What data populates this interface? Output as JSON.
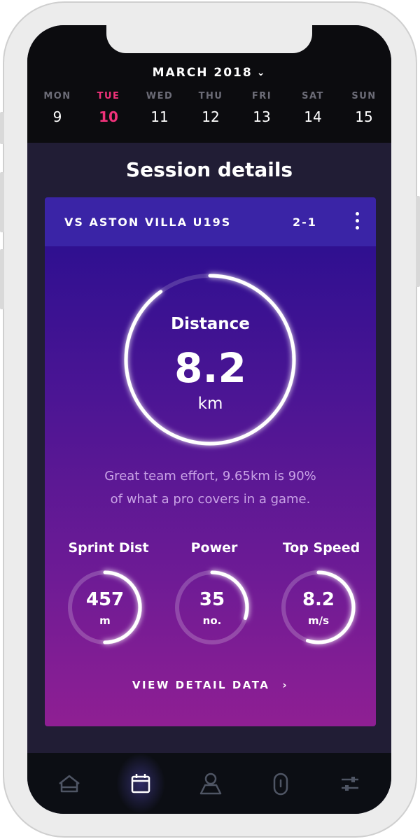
{
  "calendar": {
    "month_label": "MARCH 2018",
    "days": [
      {
        "name": "MON",
        "date": "9"
      },
      {
        "name": "TUE",
        "date": "10"
      },
      {
        "name": "WED",
        "date": "11"
      },
      {
        "name": "THU",
        "date": "12"
      },
      {
        "name": "FRI",
        "date": "13"
      },
      {
        "name": "SAT",
        "date": "14"
      },
      {
        "name": "SUN",
        "date": "15"
      }
    ],
    "active_day_index": 1
  },
  "page": {
    "title": "Session details"
  },
  "session": {
    "opponent": "VS ASTON VILLA U19S",
    "score": "2-1",
    "distance": {
      "label": "Distance",
      "value": "8.2",
      "unit": "km",
      "progress": 0.9
    },
    "summary_line1": "Great team effort, 9.65km is 90%",
    "summary_line2": "of what a pro covers in a game.",
    "stats": [
      {
        "label": "Sprint Dist",
        "value": "457",
        "unit": "m",
        "progress": 0.5
      },
      {
        "label": "Power",
        "value": "35",
        "unit": "no.",
        "progress": 0.3
      },
      {
        "label": "Top Speed",
        "value": "8.2",
        "unit": "m/s",
        "progress": 0.55
      }
    ],
    "detail_link": "VIEW DETAIL DATA"
  },
  "tabbar": {
    "items": [
      "home-icon",
      "calendar-icon",
      "profile-icon",
      "device-icon",
      "settings-icon"
    ],
    "active_index": 1
  },
  "colors": {
    "accent_pink": "#f0327a",
    "card_top": "#260e8f",
    "card_bottom": "#8f1f93",
    "text_muted": "#c9a3e6"
  }
}
